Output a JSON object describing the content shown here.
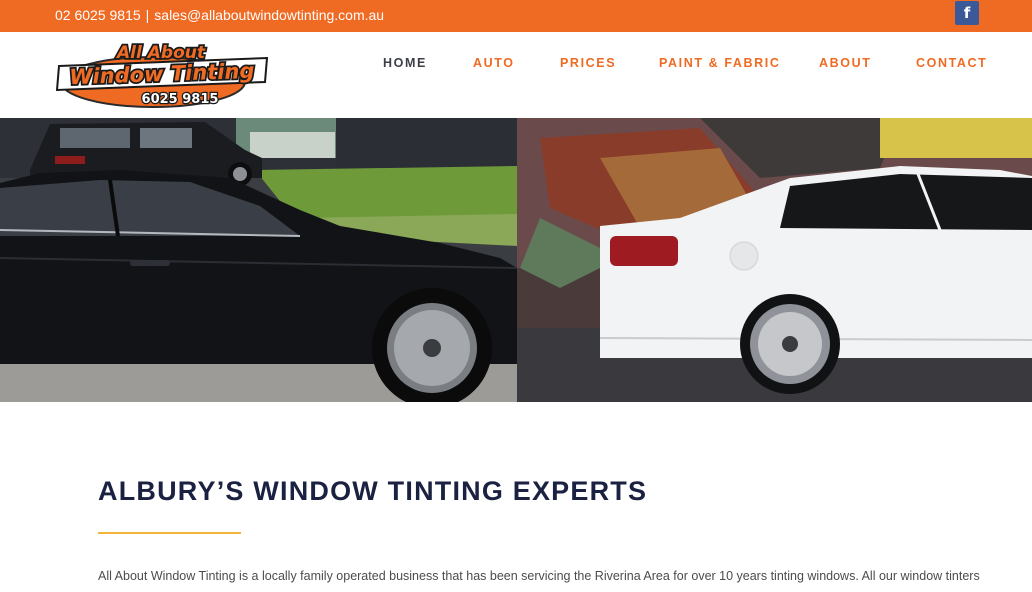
{
  "topbar": {
    "phone": "02 6025 9815",
    "separator": "|",
    "email": "sales@allaboutwindowtinting.com.au",
    "social_icon": "facebook-icon",
    "social_glyph": "f",
    "color": "#ef6a22"
  },
  "logo": {
    "line1": "All About",
    "line2": "Window Tinting",
    "phone": "6025 9815",
    "accent": "#ef6a22"
  },
  "nav": {
    "items": [
      {
        "label": "HOME",
        "active": true
      },
      {
        "label": "AUTO",
        "active": false
      },
      {
        "label": "PRICES",
        "active": false
      },
      {
        "label": "PAINT & FABRIC",
        "active": false
      },
      {
        "label": "ABOUT",
        "active": false
      },
      {
        "label": "CONTACT",
        "active": false
      }
    ]
  },
  "hero": {
    "left_image": "black-sedan-photo",
    "right_image": "white-sedan-photo"
  },
  "content": {
    "title": "ALBURY’S WINDOW TINTING EXPERTS",
    "underline_color": "#f2b53a",
    "intro": "All About Window Tinting is a locally family operated business that has been servicing the Riverina Area for over 10 years tinting windows. All our window tinters"
  }
}
